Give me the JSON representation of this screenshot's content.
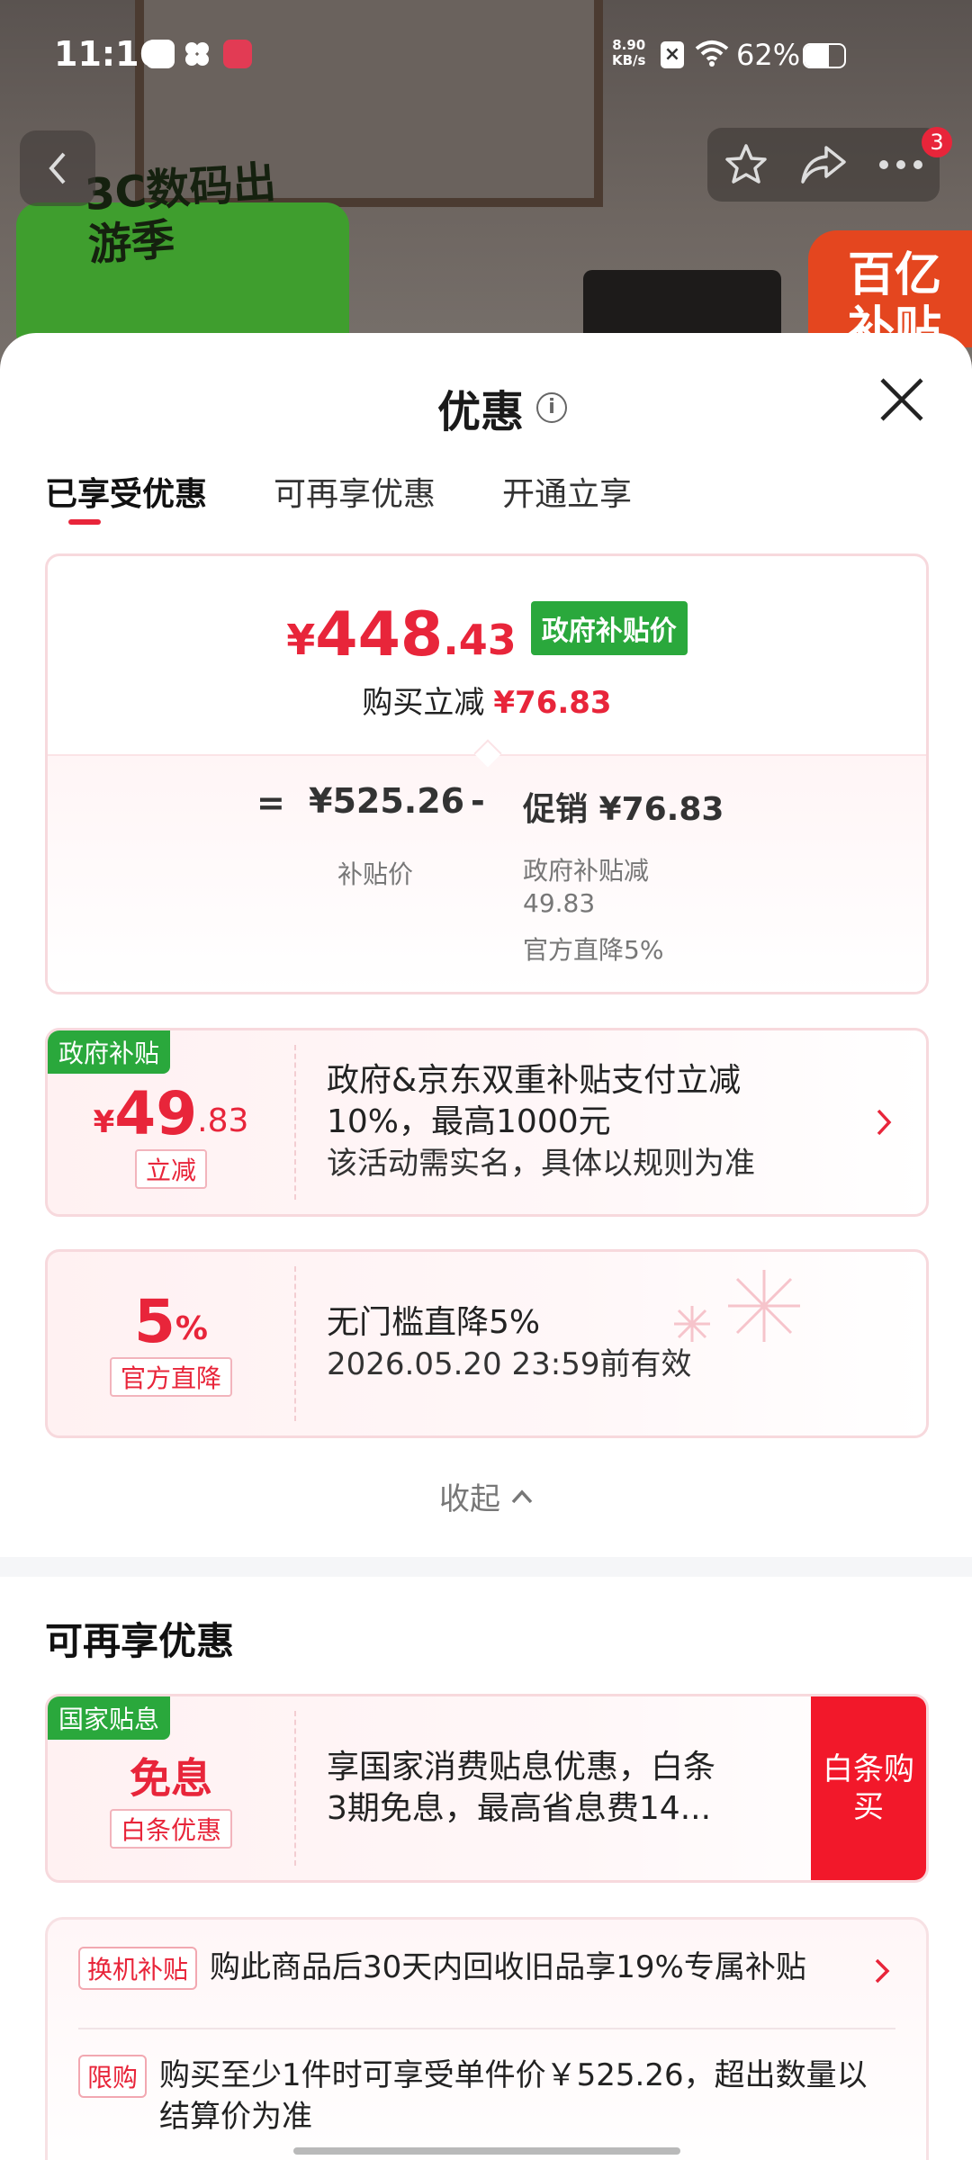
{
  "status_bar": {
    "time": "11:16",
    "net_speed_value": "8.90",
    "net_speed_unit": "KB/s",
    "battery": "62%",
    "battery_level": 0.62
  },
  "background": {
    "banner_title": "3C数码出游季",
    "badge_text": "百亿补贴"
  },
  "top_actions": {
    "notification_count": "3"
  },
  "sheet": {
    "title": "优惠",
    "tabs": [
      "已享受优惠",
      "可再享优惠",
      "开通立享"
    ],
    "price_card": {
      "currency": "¥",
      "price_int": "448",
      "price_dec": ".43",
      "tag": "政府补贴价",
      "buy_reduce_label": "购买立减",
      "buy_reduce_amount": "¥76.83",
      "eq": "=",
      "subsidy_price": "¥525.26",
      "minus": "-",
      "promo": "促销 ¥76.83",
      "subsidy_label": "补贴价",
      "promo_line1": "政府补贴减",
      "promo_line2": "49.83",
      "promo_line3": "官方直降5%"
    },
    "coupon_gov": {
      "corner_tag": "政府补贴",
      "currency": "¥",
      "amount_int": "49",
      "amount_dec": ".83",
      "small_tag": "立减",
      "line1": "政府&京东双重补贴支付立减",
      "line2": "10%，最高1000元",
      "line3": "该活动需实名，具体以规则为准"
    },
    "coupon_official": {
      "amount": "5",
      "unit": "%",
      "small_tag": "官方直降",
      "line1": "无门槛直降5%",
      "line2": "2026.05.20 23:59前有效"
    },
    "collapse_label": "收起",
    "section2_title": "可再享优惠",
    "coupon_interest": {
      "corner_tag": "国家贴息",
      "main": "免息",
      "small_tag": "白条优惠",
      "line1": "享国家消费贴息优惠，白条",
      "line2": "3期免息，最高省息费14...",
      "button": "白条购买"
    },
    "info": {
      "row1_tag": "换机补贴",
      "row1_text": "购此商品后30天内回收旧品享19%专属补贴",
      "row2_tag": "限购",
      "row2_text": "购买至少1件时可享受单件价￥525.26，超出数量以结算价为准"
    }
  }
}
